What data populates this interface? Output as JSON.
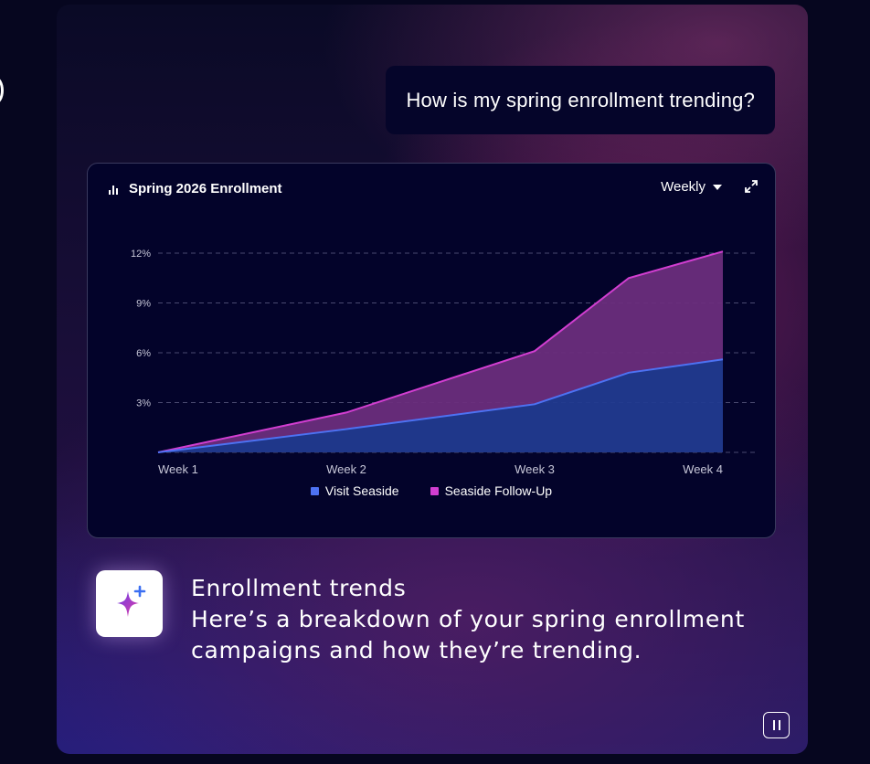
{
  "user_message": "How is my spring enrollment trending?",
  "chart_card": {
    "title": "Spring 2026 Enrollment",
    "period": "Weekly",
    "icons": {
      "title": "bar-chart-icon",
      "period": "caret-down-icon",
      "expand": "expand-icon"
    }
  },
  "assistant": {
    "title": "Enrollment trends",
    "lines": [
      "Here’s a breakdown of your spring enrollment",
      "campaigns and how they’re trending."
    ],
    "icon": "sparkle-icon"
  },
  "controls": {
    "pause_icon": "pause-icon"
  },
  "colors": {
    "visit_line": "#4d72f3",
    "visit_fill": "#213a8f",
    "followup_line": "#d23ed1",
    "followup_fill": "#6a2d7c"
  },
  "chart_data": {
    "type": "area",
    "x": [
      1,
      2,
      3,
      3.5,
      4
    ],
    "x_ticks": [
      1,
      2,
      3,
      4
    ],
    "x_tick_labels": [
      "Week 1",
      "Week 2",
      "Week 3",
      "Week 4"
    ],
    "y_ticks": [
      3,
      6,
      9,
      12
    ],
    "y_tick_labels": [
      "3%",
      "6%",
      "9%",
      "12%"
    ],
    "ylim": [
      0,
      12
    ],
    "xlim": [
      1,
      4
    ],
    "grid": true,
    "stacked": true,
    "legend_position": "bottom",
    "series": [
      {
        "name": "Visit Seaside",
        "values": [
          0,
          1.4,
          2.9,
          4.8,
          5.6
        ]
      },
      {
        "name": "Seaside Follow-Up",
        "values": [
          0,
          1,
          3.2,
          5.7,
          6.5
        ]
      }
    ]
  }
}
